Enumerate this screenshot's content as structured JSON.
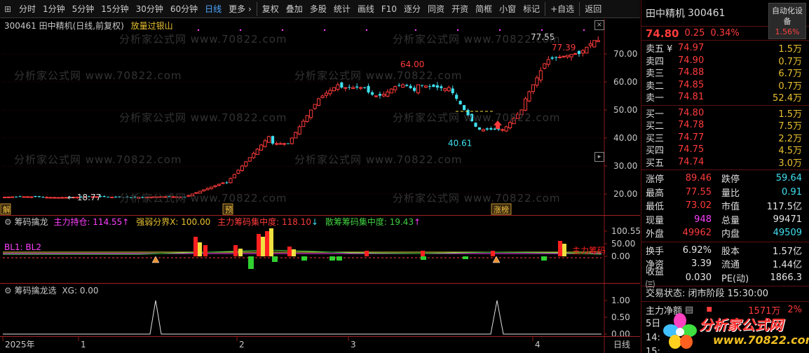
{
  "toolbar": {
    "items": [
      "分时",
      "1分钟",
      "5分钟",
      "15分钟",
      "30分钟",
      "60分钟",
      "日线",
      "更多 ›",
      "复权",
      "叠加",
      "多股",
      "统计",
      "画线",
      "F10",
      "逐分",
      "同资",
      "开资",
      "简框",
      "小窗",
      "标记",
      "+自选",
      "返回"
    ],
    "active": "日线"
  },
  "main": {
    "title": "300461 田中精机(日线,前复权)",
    "subtitle": "放量过银山",
    "watermark": "分析家公式网 www.70822.com",
    "y_ticks": [
      "70.00",
      "60.00",
      "50.00",
      "40.00",
      "30.00",
      "20.00"
    ],
    "annotations": {
      "high1": "64.00",
      "low1": "40.61",
      "start": "← 18.77",
      "top_label": "77.55",
      "top_price": "77.39"
    },
    "markers": {
      "jie": "解",
      "yu": "预",
      "zhangbang": "涨榜"
    }
  },
  "chart_data": {
    "type": "candlestick",
    "title": "300461 田中精机(日线,前复权)",
    "y_axis": [
      20,
      70
    ],
    "known_points": {
      "start_low": 18.77,
      "peak1": 64.0,
      "trough": 40.61,
      "high": 77.55,
      "last_close": 74.8
    },
    "x_ticks": [
      "2025年",
      "1",
      "2",
      "3",
      "4"
    ]
  },
  "ind1": {
    "name": "筹码擒龙",
    "zl_label": "主力持仓: ",
    "zl_value": "114.55",
    "qr_label": "强弱分界X: ",
    "qr_value": "100.00",
    "jz_label": "主力筹码集中度: ",
    "jz_value": "118.10",
    "sc_label": "散筹筹码集中度: ",
    "sc_value": "19.43",
    "legend": "BL1:  BL2",
    "right_tag": "主力筹码",
    "y_ticks": [
      "100.55",
      "50.00",
      "0.00"
    ]
  },
  "ind2": {
    "name": "筹码擒龙选",
    "xg_label": "XG: ",
    "xg_value": "0.00",
    "y_ticks": [
      "1.00",
      "0.50",
      "0.00"
    ]
  },
  "bottom": {
    "x_ticks": [
      "2025年",
      "1",
      "2",
      "3",
      "4"
    ],
    "period": "日线"
  },
  "quote": {
    "name": "田中精机",
    "code": "300461",
    "badge_line1": "自动化设",
    "badge_line2": "备",
    "badge_pct": "1.56%",
    "price": "74.80",
    "change": "0.25",
    "change_pct": "0.34%",
    "asks": [
      {
        "label": "卖五 ¥",
        "price": "74.97",
        "qty": "1.5万"
      },
      {
        "label": "卖四",
        "price": "74.90",
        "qty": "0.7万"
      },
      {
        "label": "卖三",
        "price": "74.88",
        "qty": "6.7万"
      },
      {
        "label": "卖二",
        "price": "74.85",
        "qty": "0.7万"
      },
      {
        "label": "卖一",
        "price": "74.81",
        "qty": "52.4万"
      }
    ],
    "bids": [
      {
        "label": "买一",
        "price": "74.80",
        "qty": "1.5万"
      },
      {
        "label": "买二",
        "price": "74.78",
        "qty": "7.5万"
      },
      {
        "label": "买三",
        "price": "74.77",
        "qty": "2.2万"
      },
      {
        "label": "买四",
        "price": "74.75",
        "qty": "4.5万"
      },
      {
        "label": "买五",
        "price": "74.74",
        "qty": "3.0万"
      }
    ],
    "stats1": [
      {
        "k": "涨停",
        "v": "89.46",
        "c": "red",
        "k2": "跌停",
        "v2": "59.64",
        "c2": "cyan"
      },
      {
        "k": "最高",
        "v": "77.55",
        "c": "red",
        "k2": "量比",
        "v2": "0.91",
        "c2": "cyan"
      },
      {
        "k": "最低",
        "v": "73.02",
        "c": "red",
        "k2": "市值",
        "v2": "117.5亿",
        "c2": "white"
      },
      {
        "k": "现量",
        "v": "948",
        "c": "magenta",
        "k2": "总量",
        "v2": "99471",
        "c2": "white"
      },
      {
        "k": "外盘",
        "v": "49962",
        "c": "red",
        "k2": "内盘",
        "v2": "49509",
        "c2": "cyan"
      }
    ],
    "stats2": [
      {
        "k": "换手",
        "v": "6.92%",
        "c": "white",
        "k2": "股本",
        "v2": "1.57亿",
        "c2": "white"
      },
      {
        "k": "净资",
        "v": "3.39",
        "c": "white",
        "k2": "流通",
        "v2": "1.44亿",
        "c2": "white"
      },
      {
        "k": "收益㈢",
        "v": "0.030",
        "c": "white",
        "k2": "PE(动)",
        "v2": "1866.3",
        "c2": "white"
      }
    ],
    "trade_status": "交易状态: 闭市阶段 15:30:00",
    "flow_label": "主力净额",
    "flow_amount": "1571万",
    "flow_pct": "2%",
    "foot1": "5日",
    "foot2": "14:",
    "foot3": "15:"
  },
  "logo": {
    "brand": "分析家公式网",
    "url": "www.70822.com"
  }
}
